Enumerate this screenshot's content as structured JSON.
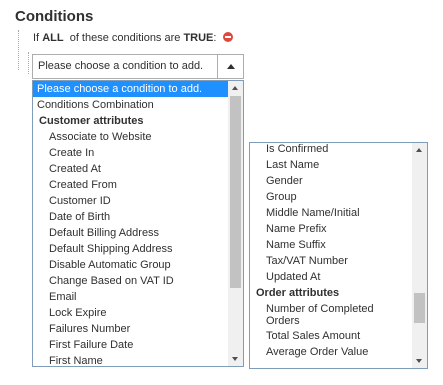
{
  "section_title": "Conditions",
  "condition": {
    "prefix": "If",
    "aggregator": "ALL",
    "middle": "of these conditions are",
    "value": "TRUE",
    "suffix": ":"
  },
  "select": {
    "current": "Please choose a condition to add."
  },
  "dropdown_left": {
    "items": [
      {
        "label": "Please choose a condition to add.",
        "kind": "selected"
      },
      {
        "label": "Conditions Combination",
        "kind": "top"
      },
      {
        "label": "Customer attributes",
        "kind": "group"
      },
      {
        "label": "Associate to Website",
        "kind": "option"
      },
      {
        "label": "Create In",
        "kind": "option"
      },
      {
        "label": "Created At",
        "kind": "option"
      },
      {
        "label": "Created From",
        "kind": "option"
      },
      {
        "label": "Customer ID",
        "kind": "option"
      },
      {
        "label": "Date of Birth",
        "kind": "option"
      },
      {
        "label": "Default Billing Address",
        "kind": "option"
      },
      {
        "label": "Default Shipping Address",
        "kind": "option"
      },
      {
        "label": "Disable Automatic Group",
        "kind": "option"
      },
      {
        "label": "Change Based on VAT ID",
        "kind": "option"
      },
      {
        "label": "Email",
        "kind": "option"
      },
      {
        "label": "Lock Expire",
        "kind": "option"
      },
      {
        "label": "Failures Number",
        "kind": "option"
      },
      {
        "label": "First Failure Date",
        "kind": "option"
      },
      {
        "label": "First Name",
        "kind": "option"
      }
    ]
  },
  "dropdown_right": {
    "items": [
      {
        "label": "Is Confirmed",
        "kind": "option"
      },
      {
        "label": "Last Name",
        "kind": "option"
      },
      {
        "label": "Gender",
        "kind": "option"
      },
      {
        "label": "Group",
        "kind": "option"
      },
      {
        "label": "Middle Name/Initial",
        "kind": "option"
      },
      {
        "label": "Name Prefix",
        "kind": "option"
      },
      {
        "label": "Name Suffix",
        "kind": "option"
      },
      {
        "label": "Tax/VAT Number",
        "kind": "option"
      },
      {
        "label": "Updated At",
        "kind": "option"
      },
      {
        "label": "Order attributes",
        "kind": "group"
      },
      {
        "label": "Number of Completed Orders",
        "kind": "option-wrap",
        "lines": [
          "Number of Completed",
          "Orders"
        ]
      },
      {
        "label": "Total Sales Amount",
        "kind": "option"
      },
      {
        "label": "Average Order Value",
        "kind": "option"
      }
    ]
  },
  "icons": {
    "remove": "remove-condition-icon",
    "select_arrow": "select-arrow-icon",
    "scroll_up": "scroll-up-icon",
    "scroll_down": "scroll-down-icon"
  },
  "colors": {
    "selected_bg": "#1e90ff",
    "remove_icon": "#e0483e",
    "listbox_border": "#7f9db9"
  }
}
